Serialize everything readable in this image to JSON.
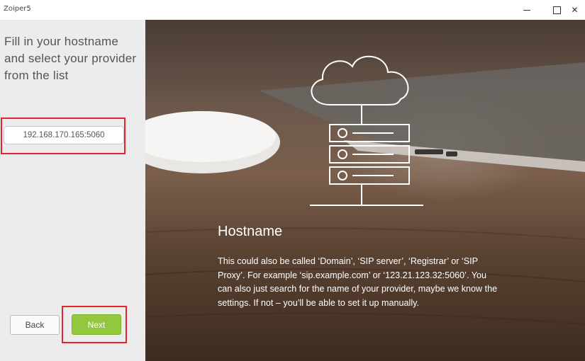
{
  "window": {
    "title": "Zoiper5"
  },
  "sidebar": {
    "heading": "Fill in your hostname and select your provider from the list",
    "hostname_value": "192.168.170.165:5060",
    "back_label": "Back",
    "next_label": "Next"
  },
  "hero": {
    "title": "Hostname",
    "body": "This could also be called ‘Domain’, ‘SIP server’, ‘Registrar’ or ‘SIP Proxy’. For example ‘sip.example.com’ or ‘123.21.123.32:5060’. You can also just search for the name of your provider, maybe we know the settings. If not – you’ll be able to set it up manually."
  },
  "colors": {
    "next_button": "#93c83e",
    "highlight_border": "#e3262d",
    "sidebar_bg": "#ececec"
  }
}
